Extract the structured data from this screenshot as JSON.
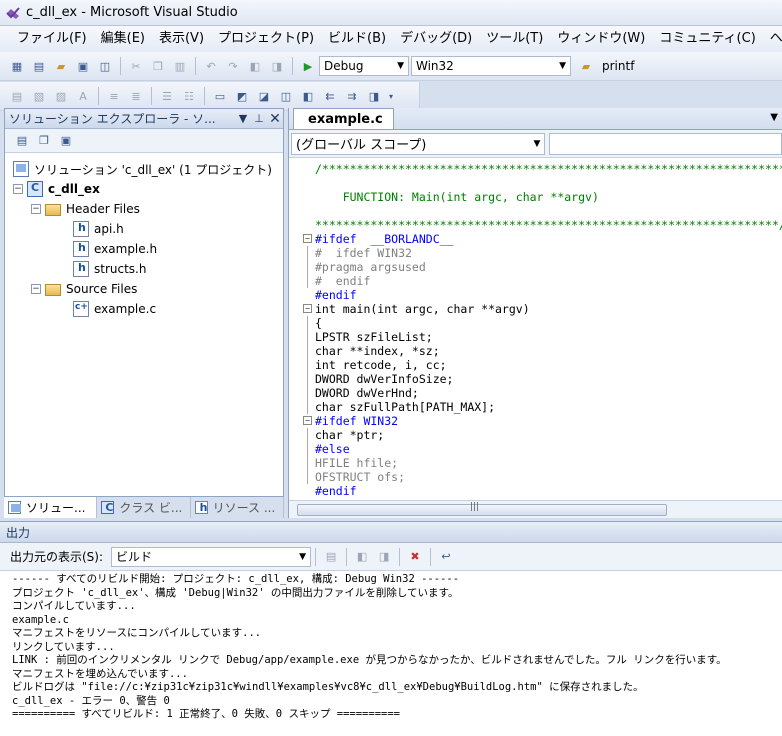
{
  "window": {
    "title": "c_dll_ex - Microsoft Visual Studio"
  },
  "menu": [
    "ファイル(F)",
    "編集(E)",
    "表示(V)",
    "プロジェクト(P)",
    "ビルド(B)",
    "デバッグ(D)",
    "ツール(T)",
    "ウィンドウ(W)",
    "コミュニティ(C)",
    "ヘルプ"
  ],
  "toolbar": {
    "config": "Debug",
    "platform": "Win32",
    "find_text": "printf"
  },
  "solution_explorer": {
    "title": "ソリューション エクスプローラ - ソ...",
    "tree": [
      {
        "label": "ソリューション 'c_dll_ex' (1 プロジェクト)"
      },
      {
        "label": "c_dll_ex"
      },
      {
        "label": "Header Files"
      },
      {
        "label": "api.h"
      },
      {
        "label": "example.h"
      },
      {
        "label": "structs.h"
      },
      {
        "label": "Source Files"
      },
      {
        "label": "example.c"
      }
    ],
    "tabs": [
      "ソリュー...",
      "クラス ビ...",
      "リソース ..."
    ]
  },
  "editor": {
    "tab": "example.c",
    "scope": "(グローバル スコープ)",
    "code": [
      "/*******************************************************************",
      "",
      "    FUNCTION: Main(int argc, char **argv)",
      "",
      "*******************************************************************/",
      "#ifdef  __BORLANDC__",
      "#  ifdef WIN32",
      "#pragma argsused",
      "#  endif",
      "#endif",
      "int main(int argc, char **argv)",
      "{",
      "LPSTR szFileList;",
      "char **index, *sz;",
      "int retcode, i, cc;",
      "DWORD dwVerInfoSize;",
      "DWORD dwVerHnd;",
      "char szFullPath[PATH_MAX];",
      "#ifdef WIN32",
      "char *ptr;",
      "#else",
      "HFILE hfile;",
      "OFSTRUCT ofs;",
      "#endif"
    ]
  },
  "output": {
    "title": "出力",
    "source_label": "出力元の表示(S):",
    "source_value": "ビルド",
    "lines": [
      "------ すべてのリビルド開始: プロジェクト: c_dll_ex, 構成: Debug Win32 ------",
      "プロジェクト 'c_dll_ex'、構成 'Debug|Win32' の中間出力ファイルを削除しています。",
      "コンパイルしています...",
      "example.c",
      "マニフェストをリソースにコンパイルしています...",
      "リンクしています...",
      "LINK : 前回のインクリメンタル リンクで Debug/app/example.exe が見つからなかったか、ビルドされませんでした。フル リンクを行います。",
      "マニフェストを埋め込んでいます...",
      "ビルドログは \"file://c:¥zip31c¥zip31c¥windll¥examples¥vc8¥c_dll_ex¥Debug¥BuildLog.htm\" に保存されました。",
      "c_dll_ex - エラー 0、警告 0",
      "========== すべてリビルド: 1 正常終了、0 失敗、0 スキップ =========="
    ]
  }
}
